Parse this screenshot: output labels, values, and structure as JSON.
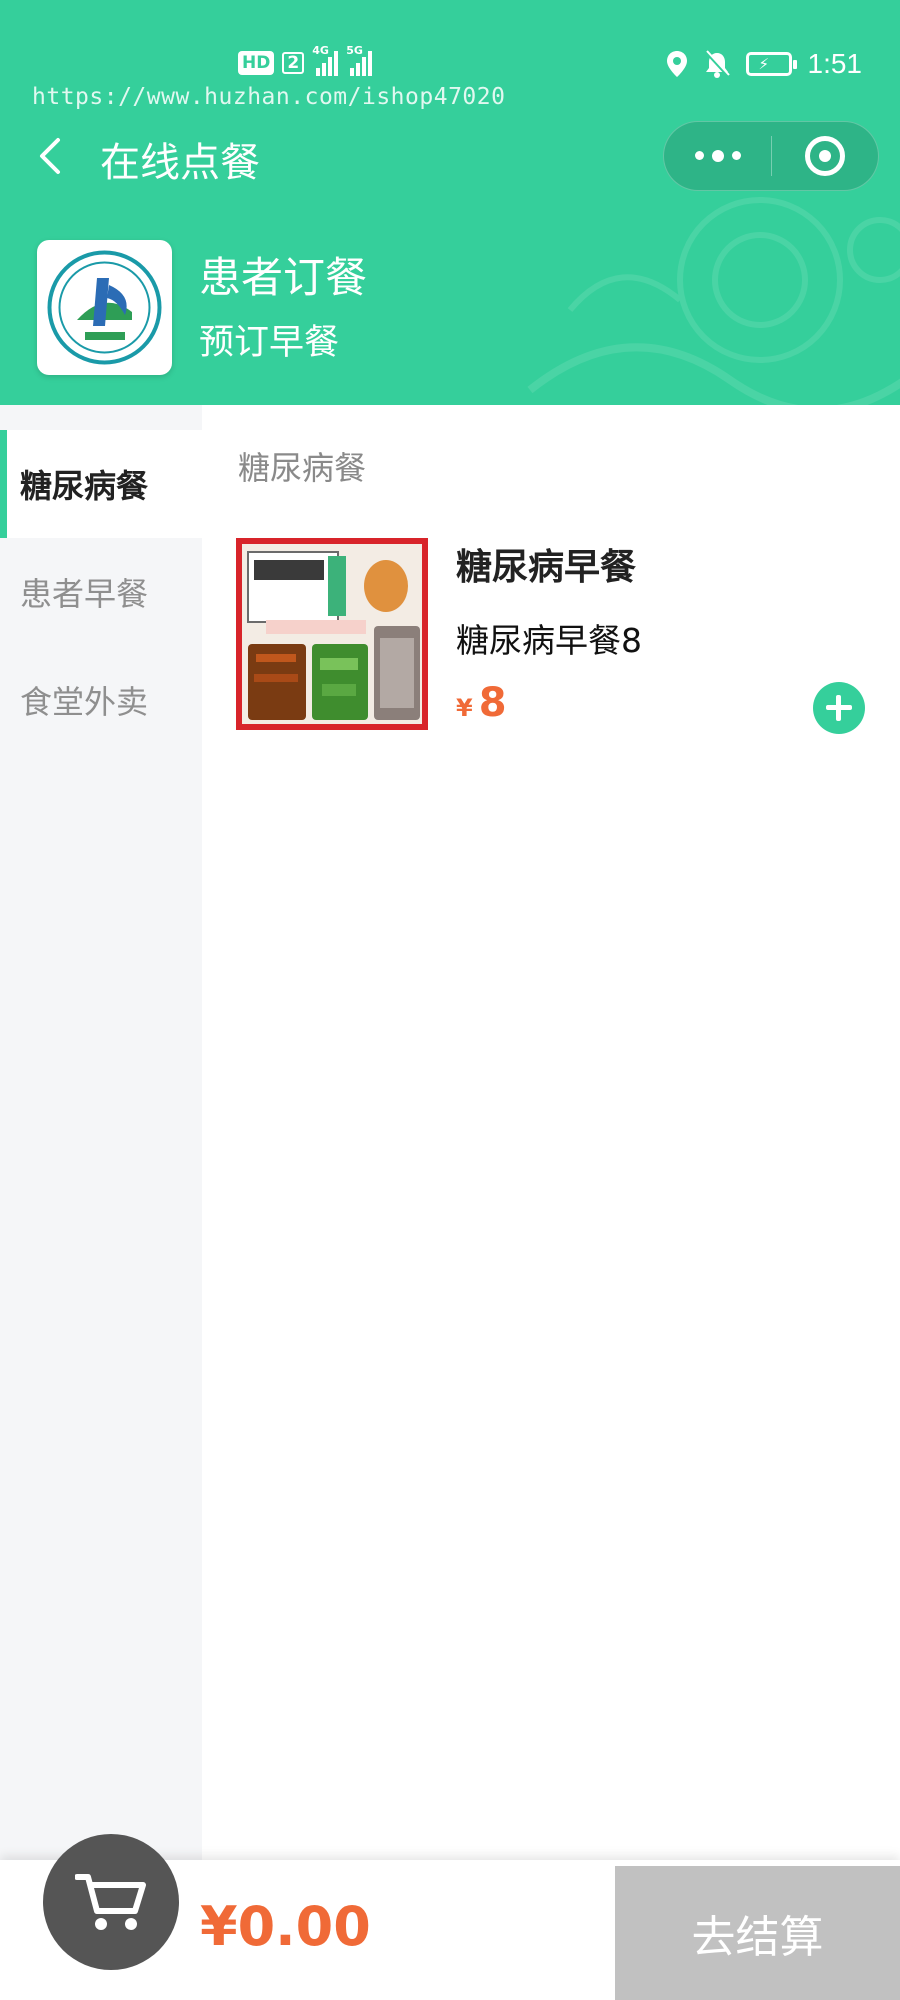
{
  "status_bar": {
    "hd_label": "HD",
    "sim_label": "2",
    "network_1": "4G",
    "network_2": "5G",
    "time": "1:51"
  },
  "watermark": "https://www.huzhan.com/ishop47020",
  "nav": {
    "title": "在线点餐",
    "back_icon": "chevron-left-icon",
    "more_icon": "more-dots-icon",
    "close_icon": "target-icon"
  },
  "store": {
    "name": "患者订餐",
    "subtitle": "预订早餐"
  },
  "categories": [
    {
      "label": "糖尿病餐",
      "active": true
    },
    {
      "label": "患者早餐",
      "active": false
    },
    {
      "label": "食堂外卖",
      "active": false
    }
  ],
  "section": {
    "title": "糖尿病餐"
  },
  "products": [
    {
      "name": "糖尿病早餐",
      "description": "糖尿病早餐8",
      "currency": "¥",
      "price": "8"
    }
  ],
  "cart": {
    "total": "¥0.00",
    "checkout_label": "去结算"
  },
  "colors": {
    "brand_green": "#35cf9b",
    "price_orange": "#f06a37",
    "checkout_disabled": "#c1c1c1",
    "cart_dark": "#555555"
  }
}
